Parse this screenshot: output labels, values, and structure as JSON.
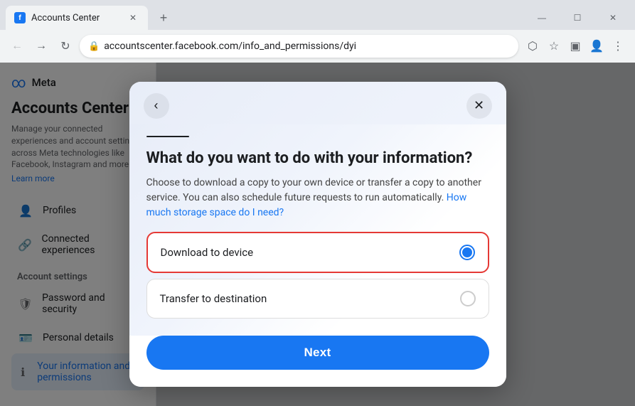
{
  "browser": {
    "tab_title": "Accounts Center",
    "tab_favicon": "f",
    "address": "accountscenter.facebook.com/info_and_permissions/dyi",
    "address_display": "accountscenter.facebook.com/info_and_permissions/dyi"
  },
  "sidebar": {
    "meta_label": "Meta",
    "title": "Accounts Center",
    "description": "Manage your connected experiences and account settings across Meta technologies like Facebook, Instagram and more.",
    "learn_more": "Learn more",
    "nav_items": [
      {
        "label": "Profiles",
        "icon": "👤"
      },
      {
        "label": "Connected experiences",
        "icon": "🔗"
      }
    ],
    "account_settings_title": "Account settings",
    "account_settings_items": [
      {
        "label": "Password and security",
        "icon": "🛡"
      },
      {
        "label": "Personal details",
        "icon": "🪪"
      },
      {
        "label": "Your information and permissions",
        "icon": "ℹ"
      }
    ]
  },
  "modal": {
    "back_icon": "‹",
    "close_icon": "×",
    "title": "What do you want to do with your information?",
    "description": "Choose to download a copy to your own device or transfer a copy to another service. You can also schedule future requests to run automatically.",
    "link_text": "How much storage space do I need?",
    "options": [
      {
        "label": "Download to device",
        "selected": true
      },
      {
        "label": "Transfer to destination",
        "selected": false
      }
    ],
    "next_button": "Next"
  }
}
